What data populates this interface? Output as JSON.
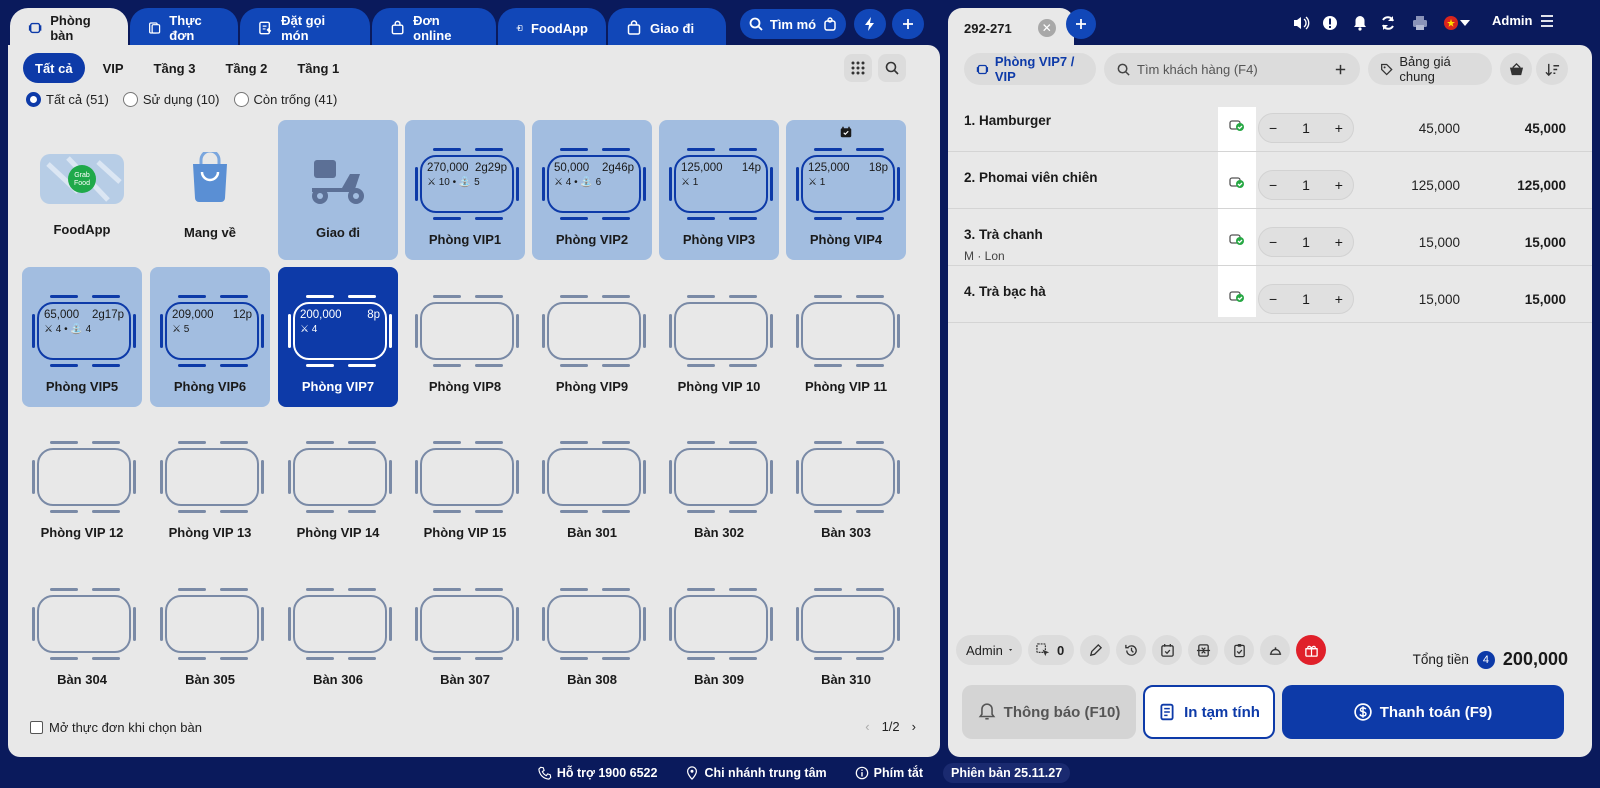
{
  "top_tabs": [
    {
      "label": "Phòng bàn"
    },
    {
      "label": "Thực đơn"
    },
    {
      "label": "Đặt gọi món"
    },
    {
      "label": "Đơn online"
    },
    {
      "label": "FoodApp"
    },
    {
      "label": "Giao đi"
    }
  ],
  "search_menu_label": "Tìm mó",
  "filters": {
    "floor_tabs": [
      "Tất cả",
      "VIP",
      "Tầng 3",
      "Tầng 2",
      "Tầng 1"
    ],
    "status": [
      {
        "label": "Tất cả (51)"
      },
      {
        "label": "Sử dụng (10)"
      },
      {
        "label": "Còn trống (41)"
      }
    ]
  },
  "special_cells": [
    {
      "label": "FoodApp",
      "logo_text": "Grab Food"
    },
    {
      "label": "Mang về"
    },
    {
      "label": "Giao đi"
    }
  ],
  "tables": [
    {
      "name": "Phòng VIP1",
      "amount": "270,000",
      "time": "2g29p",
      "diners": "10",
      "children": "5"
    },
    {
      "name": "Phòng VIP2",
      "amount": "50,000",
      "time": "2g46p",
      "diners": "4",
      "children": "6"
    },
    {
      "name": "Phòng VIP3",
      "amount": "125,000",
      "time": "14p",
      "diners": "1",
      "children": ""
    },
    {
      "name": "Phòng VIP4",
      "amount": "125,000",
      "time": "18p",
      "diners": "1",
      "children": ""
    },
    {
      "name": "Phòng VIP5",
      "amount": "65,000",
      "time": "2g17p",
      "diners": "4",
      "children": "4"
    },
    {
      "name": "Phòng VIP6",
      "amount": "209,000",
      "time": "12p",
      "diners": "5",
      "children": ""
    },
    {
      "name": "Phòng VIP7",
      "amount": "200,000",
      "time": "8p",
      "diners": "4",
      "children": ""
    },
    {
      "name": "Phòng VIP8"
    },
    {
      "name": "Phòng VIP9"
    },
    {
      "name": "Phòng VIP 10"
    },
    {
      "name": "Phòng VIP 11"
    },
    {
      "name": "Phòng VIP 12"
    },
    {
      "name": "Phòng VIP 13"
    },
    {
      "name": "Phòng VIP 14"
    },
    {
      "name": "Phòng VIP 15"
    },
    {
      "name": "Bàn 301"
    },
    {
      "name": "Bàn 302"
    },
    {
      "name": "Bàn 303"
    },
    {
      "name": "Bàn 304"
    },
    {
      "name": "Bàn 305"
    },
    {
      "name": "Bàn 306"
    },
    {
      "name": "Bàn 307"
    },
    {
      "name": "Bàn 308"
    },
    {
      "name": "Bàn 309"
    },
    {
      "name": "Bàn 310"
    }
  ],
  "open_menu_checkbox": "Mở thực đơn khi chọn bàn",
  "pager": "1/2",
  "order": {
    "tab_label": "292-271",
    "room_label": "Phòng VIP7 / VIP",
    "customer_placeholder": "Tìm khách hàng (F4)",
    "price_list": "Bảng giá chung",
    "user": "Admin",
    "items": [
      {
        "name": "1. Hamburger",
        "note": "",
        "qty": "1",
        "price": "45,000",
        "total": "45,000"
      },
      {
        "name": "2. Phomai viên chiên",
        "note": "",
        "qty": "1",
        "price": "125,000",
        "total": "125,000"
      },
      {
        "name": "3. Trà chanh",
        "note": "M · Lon",
        "qty": "1",
        "price": "15,000",
        "total": "15,000"
      },
      {
        "name": "4. Trà bạc hà",
        "note": "",
        "qty": "1",
        "price": "15,000",
        "total": "15,000"
      }
    ],
    "staff": "Admin",
    "guest_count": "0",
    "total_label": "Tổng tiền",
    "total_badge": "4",
    "total_amount": "200,000",
    "notify_btn": "Thông báo (F10)",
    "print_btn": "In tạm tính",
    "pay_btn": "Thanh toán (F9)"
  },
  "footer": {
    "support": "Hỗ trợ 1900 6522",
    "branch": "Chi nhánh trung tâm",
    "shortcuts": "Phím tắt",
    "version": "Phiên bản 25.11.27"
  },
  "colors": {
    "primary": "#0d3aa8",
    "accent_blue": "#1147b8",
    "background": "#0a1a5c",
    "used_table": "#a2bde0",
    "gift": "#e0202a"
  }
}
